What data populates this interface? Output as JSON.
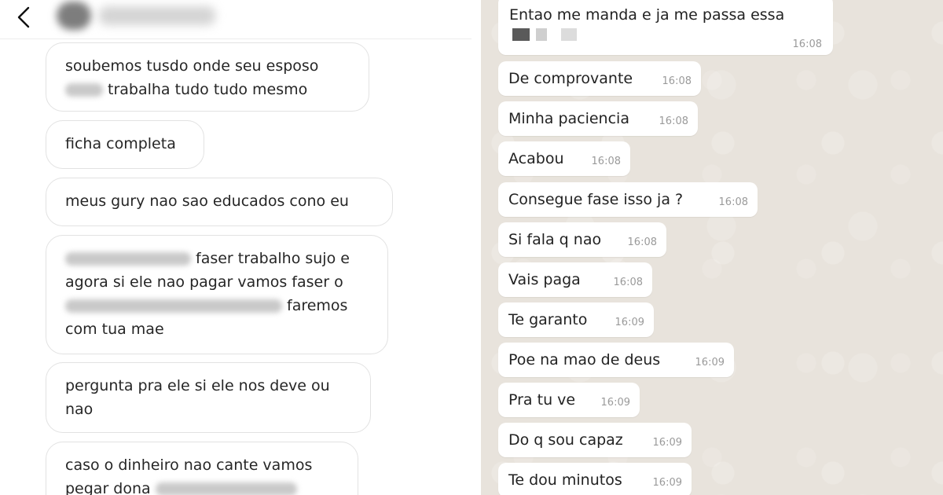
{
  "instagram": {
    "messages": [
      {
        "pre": "soubemos tusdo onde seu esposo",
        "post": "trabalha tudo tudo mesmo"
      },
      {
        "text": "ficha completa"
      },
      {
        "text": "meus gury nao sao educados cono eu"
      },
      {
        "l1_after": "faser trabalho sujo e",
        "l2": "agora si ele nao pagar vamos faser o",
        "l3_after": "faremos",
        "l4": "com tua mae"
      },
      {
        "l1": "pergunta pra ele si ele nos deve ou",
        "l2": "nao"
      },
      {
        "l1": "caso o dinheiro nao cante vamos",
        "l2_pre": "pegar dona"
      }
    ]
  },
  "whatsapp": {
    "first": {
      "text": "Entao me manda e ja me passa essa",
      "time": "16:08"
    },
    "messages": [
      {
        "text": "De comprovante",
        "time": "16:08"
      },
      {
        "text": "Minha paciencia",
        "time": "16:08"
      },
      {
        "text": "Acabou",
        "time": "16:08"
      },
      {
        "text": "Consegue fase isso ja ?",
        "time": "16:08"
      },
      {
        "text": "Si fala q nao",
        "time": "16:08"
      },
      {
        "text": "Vais paga",
        "time": "16:08"
      },
      {
        "text": "Te garanto",
        "time": "16:09"
      },
      {
        "text": "Poe na mao de deus",
        "time": "16:09"
      },
      {
        "text": "Pra tu ve",
        "time": "16:09"
      },
      {
        "text": "Do q sou capaz",
        "time": "16:09"
      },
      {
        "text": "Te dou minutos",
        "time": "16:09"
      }
    ]
  }
}
